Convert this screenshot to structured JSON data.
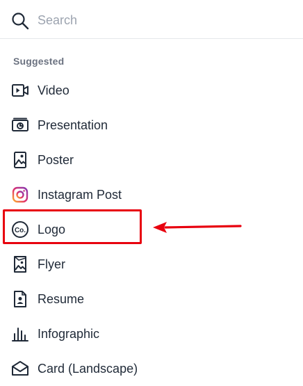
{
  "search": {
    "placeholder": "Search",
    "icon": "search-icon"
  },
  "suggested": {
    "label": "Suggested",
    "items": [
      {
        "label": "Video",
        "icon": "video-icon"
      },
      {
        "label": "Presentation",
        "icon": "presentation-icon"
      },
      {
        "label": "Poster",
        "icon": "poster-icon"
      },
      {
        "label": "Instagram Post",
        "icon": "instagram-icon"
      },
      {
        "label": "Logo",
        "icon": "logo-icon"
      },
      {
        "label": "Flyer",
        "icon": "flyer-icon"
      },
      {
        "label": "Resume",
        "icon": "resume-icon"
      },
      {
        "label": "Infographic",
        "icon": "infographic-icon"
      },
      {
        "label": "Card (Landscape)",
        "icon": "card-icon"
      }
    ]
  },
  "annotation": {
    "highlighted_item": "Logo",
    "color": "#e8000e"
  },
  "colors": {
    "text": "#1f2937",
    "muted": "#6b7280",
    "placeholder": "#9ca3af",
    "divider": "#e5e7eb"
  }
}
